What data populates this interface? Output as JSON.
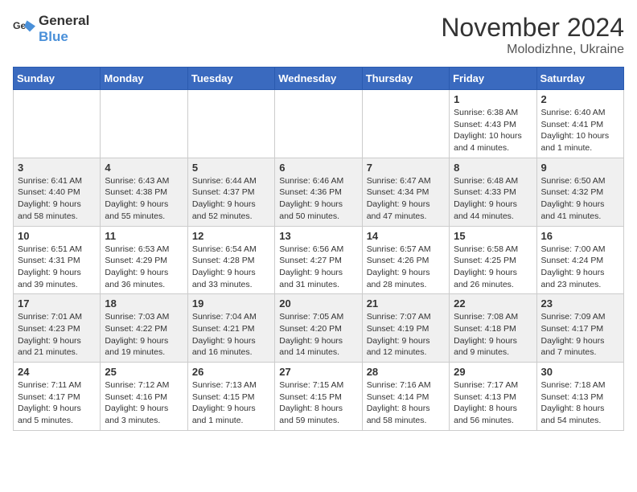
{
  "logo": {
    "general": "General",
    "blue": "Blue"
  },
  "title": "November 2024",
  "location": "Molodizhne, Ukraine",
  "days_of_week": [
    "Sunday",
    "Monday",
    "Tuesday",
    "Wednesday",
    "Thursday",
    "Friday",
    "Saturday"
  ],
  "weeks": [
    [
      {
        "day": "",
        "info": ""
      },
      {
        "day": "",
        "info": ""
      },
      {
        "day": "",
        "info": ""
      },
      {
        "day": "",
        "info": ""
      },
      {
        "day": "",
        "info": ""
      },
      {
        "day": "1",
        "info": "Sunrise: 6:38 AM\nSunset: 4:43 PM\nDaylight: 10 hours and 4 minutes."
      },
      {
        "day": "2",
        "info": "Sunrise: 6:40 AM\nSunset: 4:41 PM\nDaylight: 10 hours and 1 minute."
      }
    ],
    [
      {
        "day": "3",
        "info": "Sunrise: 6:41 AM\nSunset: 4:40 PM\nDaylight: 9 hours and 58 minutes."
      },
      {
        "day": "4",
        "info": "Sunrise: 6:43 AM\nSunset: 4:38 PM\nDaylight: 9 hours and 55 minutes."
      },
      {
        "day": "5",
        "info": "Sunrise: 6:44 AM\nSunset: 4:37 PM\nDaylight: 9 hours and 52 minutes."
      },
      {
        "day": "6",
        "info": "Sunrise: 6:46 AM\nSunset: 4:36 PM\nDaylight: 9 hours and 50 minutes."
      },
      {
        "day": "7",
        "info": "Sunrise: 6:47 AM\nSunset: 4:34 PM\nDaylight: 9 hours and 47 minutes."
      },
      {
        "day": "8",
        "info": "Sunrise: 6:48 AM\nSunset: 4:33 PM\nDaylight: 9 hours and 44 minutes."
      },
      {
        "day": "9",
        "info": "Sunrise: 6:50 AM\nSunset: 4:32 PM\nDaylight: 9 hours and 41 minutes."
      }
    ],
    [
      {
        "day": "10",
        "info": "Sunrise: 6:51 AM\nSunset: 4:31 PM\nDaylight: 9 hours and 39 minutes."
      },
      {
        "day": "11",
        "info": "Sunrise: 6:53 AM\nSunset: 4:29 PM\nDaylight: 9 hours and 36 minutes."
      },
      {
        "day": "12",
        "info": "Sunrise: 6:54 AM\nSunset: 4:28 PM\nDaylight: 9 hours and 33 minutes."
      },
      {
        "day": "13",
        "info": "Sunrise: 6:56 AM\nSunset: 4:27 PM\nDaylight: 9 hours and 31 minutes."
      },
      {
        "day": "14",
        "info": "Sunrise: 6:57 AM\nSunset: 4:26 PM\nDaylight: 9 hours and 28 minutes."
      },
      {
        "day": "15",
        "info": "Sunrise: 6:58 AM\nSunset: 4:25 PM\nDaylight: 9 hours and 26 minutes."
      },
      {
        "day": "16",
        "info": "Sunrise: 7:00 AM\nSunset: 4:24 PM\nDaylight: 9 hours and 23 minutes."
      }
    ],
    [
      {
        "day": "17",
        "info": "Sunrise: 7:01 AM\nSunset: 4:23 PM\nDaylight: 9 hours and 21 minutes."
      },
      {
        "day": "18",
        "info": "Sunrise: 7:03 AM\nSunset: 4:22 PM\nDaylight: 9 hours and 19 minutes."
      },
      {
        "day": "19",
        "info": "Sunrise: 7:04 AM\nSunset: 4:21 PM\nDaylight: 9 hours and 16 minutes."
      },
      {
        "day": "20",
        "info": "Sunrise: 7:05 AM\nSunset: 4:20 PM\nDaylight: 9 hours and 14 minutes."
      },
      {
        "day": "21",
        "info": "Sunrise: 7:07 AM\nSunset: 4:19 PM\nDaylight: 9 hours and 12 minutes."
      },
      {
        "day": "22",
        "info": "Sunrise: 7:08 AM\nSunset: 4:18 PM\nDaylight: 9 hours and 9 minutes."
      },
      {
        "day": "23",
        "info": "Sunrise: 7:09 AM\nSunset: 4:17 PM\nDaylight: 9 hours and 7 minutes."
      }
    ],
    [
      {
        "day": "24",
        "info": "Sunrise: 7:11 AM\nSunset: 4:17 PM\nDaylight: 9 hours and 5 minutes."
      },
      {
        "day": "25",
        "info": "Sunrise: 7:12 AM\nSunset: 4:16 PM\nDaylight: 9 hours and 3 minutes."
      },
      {
        "day": "26",
        "info": "Sunrise: 7:13 AM\nSunset: 4:15 PM\nDaylight: 9 hours and 1 minute."
      },
      {
        "day": "27",
        "info": "Sunrise: 7:15 AM\nSunset: 4:15 PM\nDaylight: 8 hours and 59 minutes."
      },
      {
        "day": "28",
        "info": "Sunrise: 7:16 AM\nSunset: 4:14 PM\nDaylight: 8 hours and 58 minutes."
      },
      {
        "day": "29",
        "info": "Sunrise: 7:17 AM\nSunset: 4:13 PM\nDaylight: 8 hours and 56 minutes."
      },
      {
        "day": "30",
        "info": "Sunrise: 7:18 AM\nSunset: 4:13 PM\nDaylight: 8 hours and 54 minutes."
      }
    ]
  ]
}
